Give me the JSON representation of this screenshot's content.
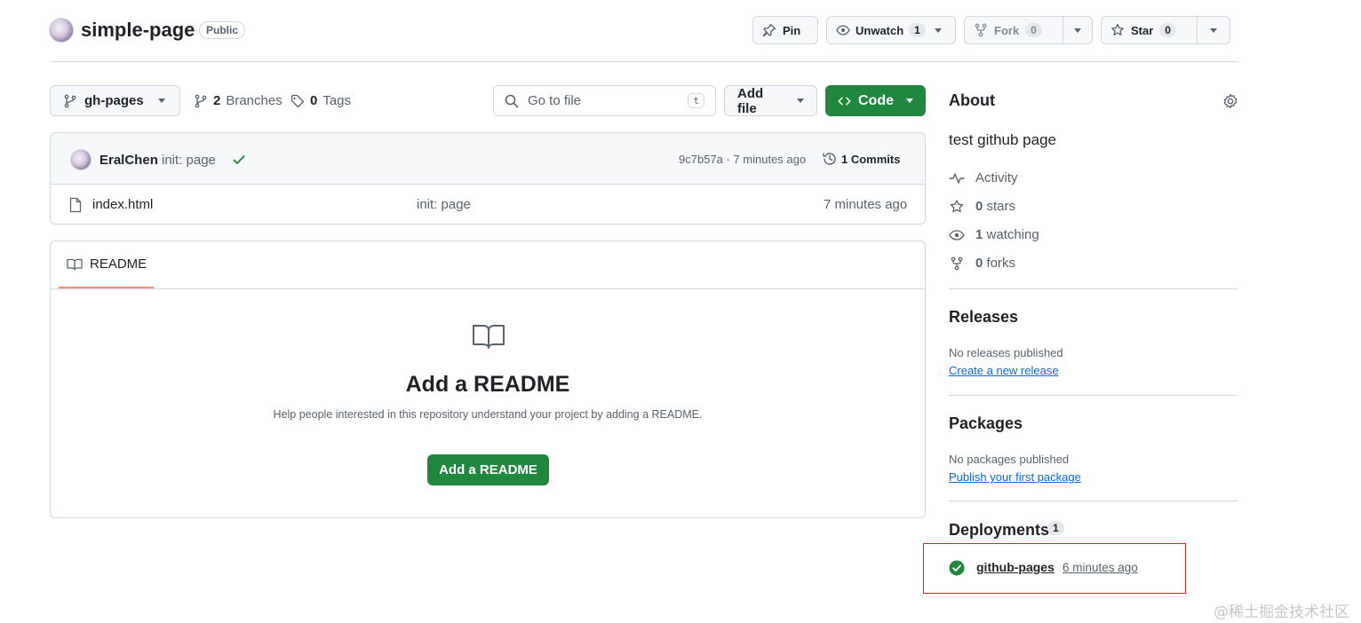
{
  "repo": {
    "name": "simple-page",
    "visibility": "Public"
  },
  "actions": {
    "pin": "Pin",
    "unwatch": "Unwatch",
    "unwatch_count": "1",
    "fork": "Fork",
    "fork_count": "0",
    "star": "Star",
    "star_count": "0"
  },
  "toolbar": {
    "branch": "gh-pages",
    "branches_count": "2",
    "branches_label": "Branches",
    "tags_count": "0",
    "tags_label": "Tags",
    "search_placeholder": "Go to file",
    "search_kbd": "t",
    "add_file": "Add file",
    "code": "Code"
  },
  "commit": {
    "author": "EralChen",
    "message": "init: page",
    "meta": "9c7b57a · 7 minutes ago",
    "commits_label": "1 Commits"
  },
  "files": [
    {
      "name": "index.html",
      "message": "init: page",
      "time": "7 minutes ago"
    }
  ],
  "readme": {
    "tab": "README",
    "heading": "Add a README",
    "help": "Help people interested in this repository understand your project by adding a README.",
    "button": "Add a README"
  },
  "about": {
    "title": "About",
    "description": "test github page",
    "activity": "Activity",
    "stars_count": "0",
    "stars_label": "stars",
    "watching_count": "1",
    "watching_label": "watching",
    "forks_count": "0",
    "forks_label": "forks"
  },
  "releases": {
    "title": "Releases",
    "none": "No releases published",
    "create_link": "Create a new release"
  },
  "packages": {
    "title": "Packages",
    "none": "No packages published",
    "publish_link": "Publish your first package"
  },
  "deployments": {
    "title": "Deployments",
    "count": "1",
    "env": "github-pages",
    "time": "6 minutes ago"
  },
  "watermark": "@稀土掘金技术社区",
  "colors": {
    "green": "#1f883d",
    "link": "#0969da",
    "highlight_box": "#d1242f",
    "tab_underline": "#fd8c73"
  }
}
